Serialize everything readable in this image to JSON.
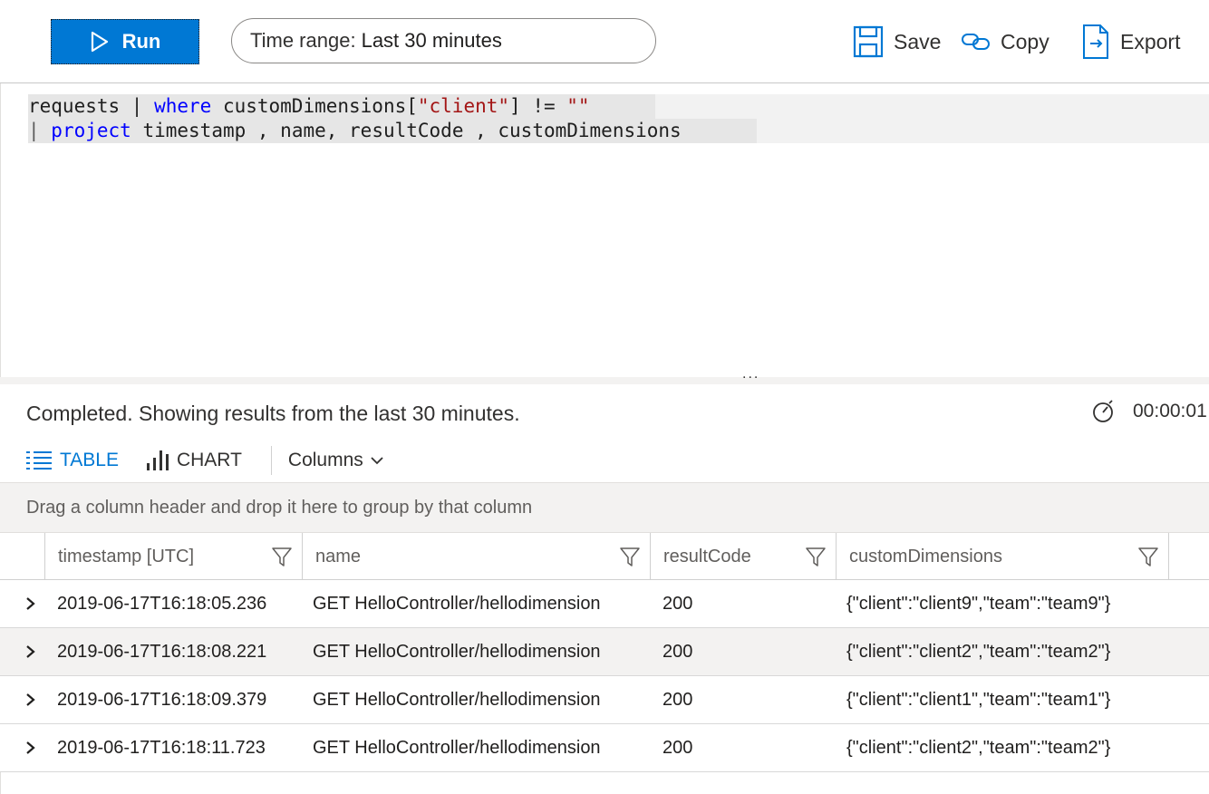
{
  "toolbar": {
    "run_label": "Run",
    "time_range_label": "Time range:",
    "time_range_value": "Last 30 minutes",
    "save_label": "Save",
    "copy_label": "Copy",
    "export_label": "Export",
    "accent_color": "#0078d4"
  },
  "editor": {
    "line1": {
      "t1": "requests | ",
      "kw_where": "where",
      "t2": " customDimensions[",
      "str_client": "\"client\"",
      "t3": "] != ",
      "str_empty": "\"\""
    },
    "line2": {
      "pipe": "| ",
      "kw_project": "project",
      "t1": " timestamp , name, resultCode , customDimensions"
    },
    "splitter_dots": "..."
  },
  "results": {
    "status": "Completed. Showing results from the last 30 minutes.",
    "elapsed": "00:00:01",
    "tabs": {
      "table": "TABLE",
      "chart": "CHART"
    },
    "columns_label": "Columns",
    "group_hint": "Drag a column header and drop it here to group by that column",
    "headers": [
      "timestamp [UTC]",
      "name",
      "resultCode",
      "customDimensions"
    ],
    "rows": [
      {
        "timestamp": "2019-06-17T16:18:05.236",
        "name": "GET HelloController/hellodimension",
        "resultCode": "200",
        "customDimensions": "{\"client\":\"client9\",\"team\":\"team9\"}"
      },
      {
        "timestamp": "2019-06-17T16:18:08.221",
        "name": "GET HelloController/hellodimension",
        "resultCode": "200",
        "customDimensions": "{\"client\":\"client2\",\"team\":\"team2\"}"
      },
      {
        "timestamp": "2019-06-17T16:18:09.379",
        "name": "GET HelloController/hellodimension",
        "resultCode": "200",
        "customDimensions": "{\"client\":\"client1\",\"team\":\"team1\"}"
      },
      {
        "timestamp": "2019-06-17T16:18:11.723",
        "name": "GET HelloController/hellodimension",
        "resultCode": "200",
        "customDimensions": "{\"client\":\"client2\",\"team\":\"team2\"}"
      }
    ]
  }
}
